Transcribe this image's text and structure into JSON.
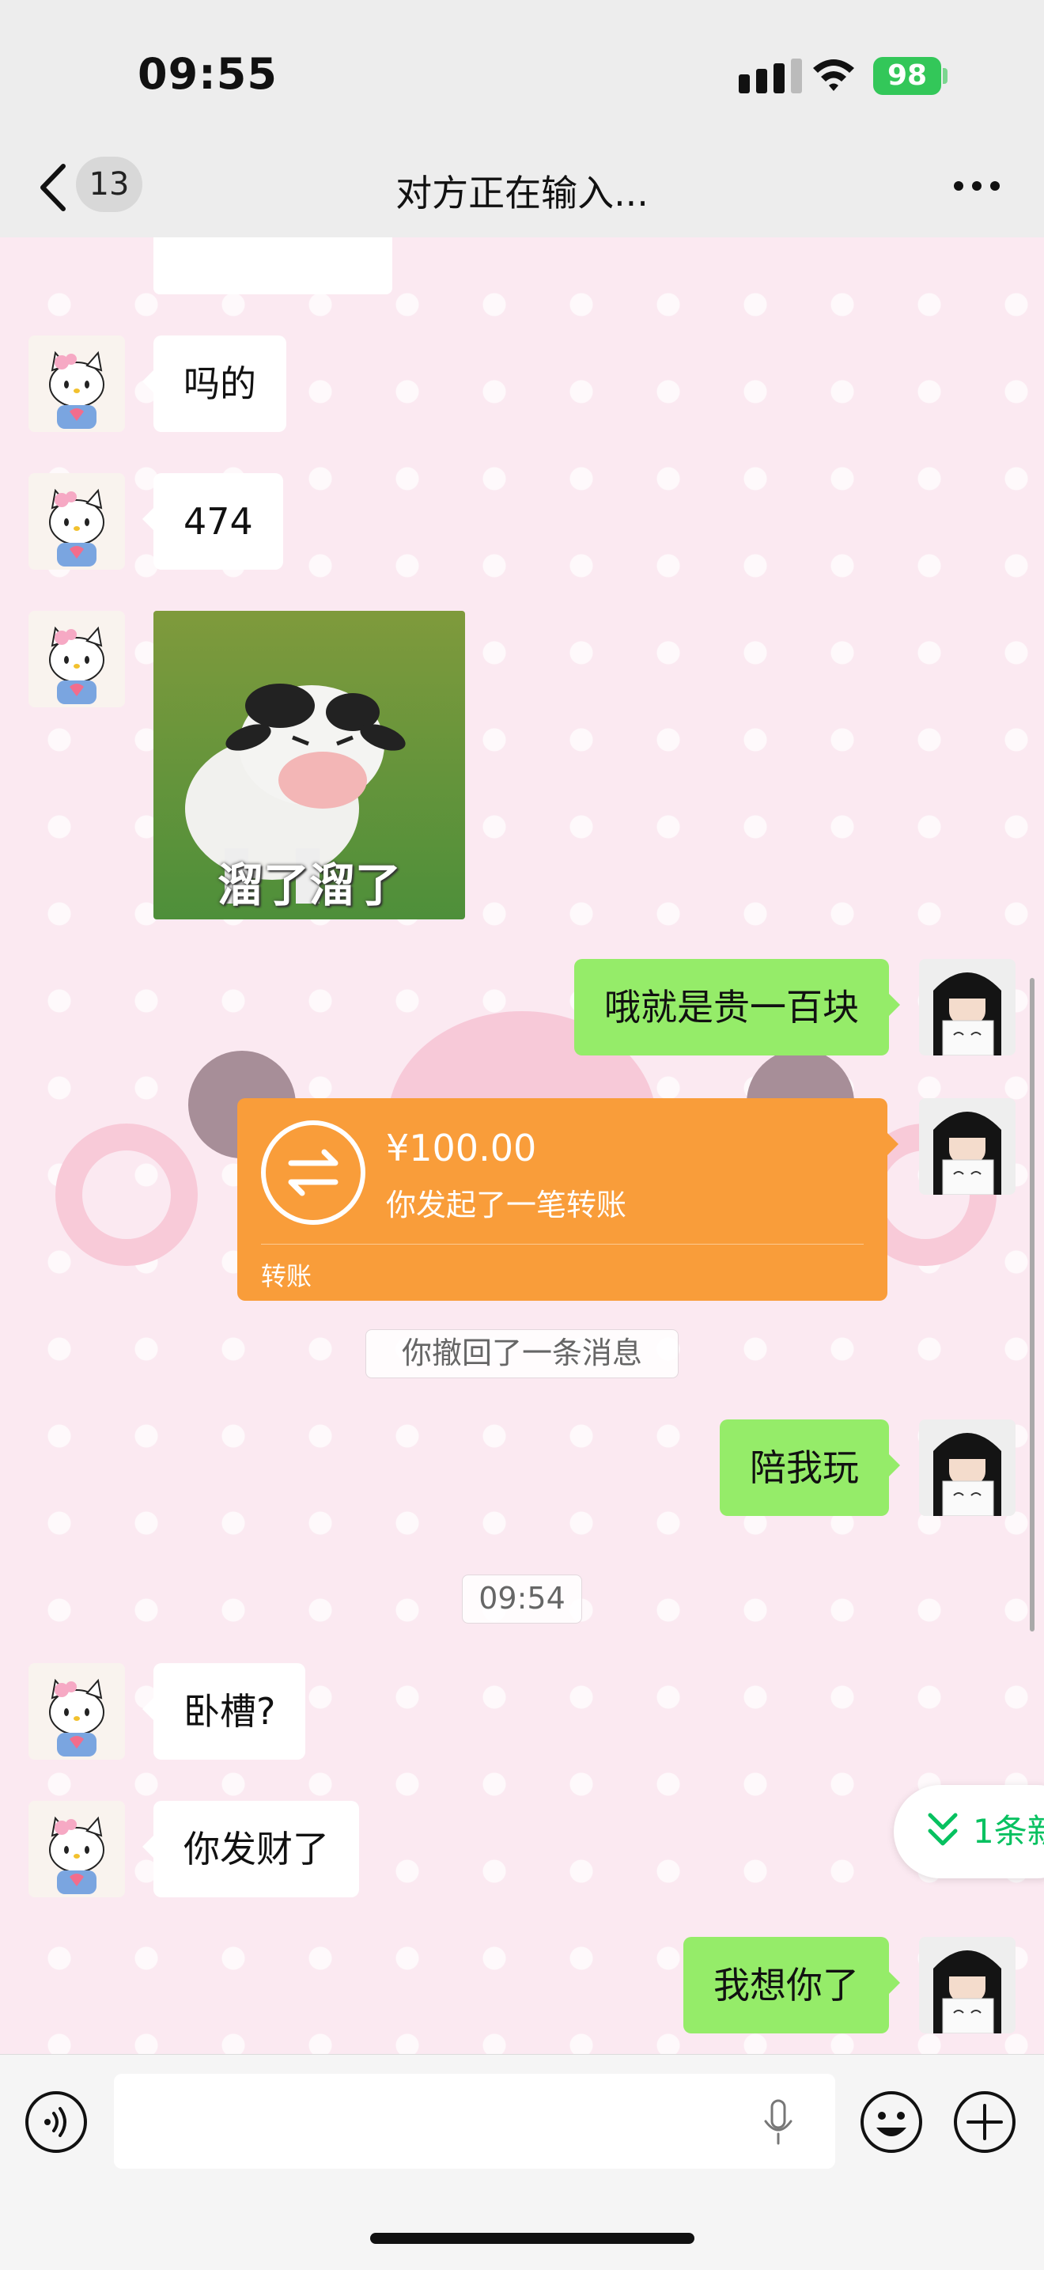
{
  "status": {
    "time": "09:55",
    "battery": "98"
  },
  "nav": {
    "unread": "13",
    "title": "对方正在输入..."
  },
  "messages": {
    "m1": "吗的",
    "m2": "474",
    "sticker_text": "溜了溜了",
    "m3": "哦就是贵一百块",
    "transfer": {
      "amount": "¥100.00",
      "desc": "你发起了一笔转账",
      "label": "转账"
    },
    "recalled": "你撤回了一条消息",
    "m4": "陪我玩",
    "timestamp": "09:54",
    "m5": "卧槽?",
    "m6": "你发财了",
    "m7": "我想你了"
  },
  "new_messages": "1条新",
  "colors": {
    "outgoing": "#95ec69",
    "incoming": "#ffffff",
    "transfer": "#f99d3a",
    "chat_bg": "#fbe9f1",
    "accent": "#07c160"
  },
  "icons": [
    "back-chevron-icon",
    "more-icon",
    "voice-icon",
    "mic-icon",
    "emoji-icon",
    "plus-icon",
    "transfer-arrows-icon"
  ]
}
